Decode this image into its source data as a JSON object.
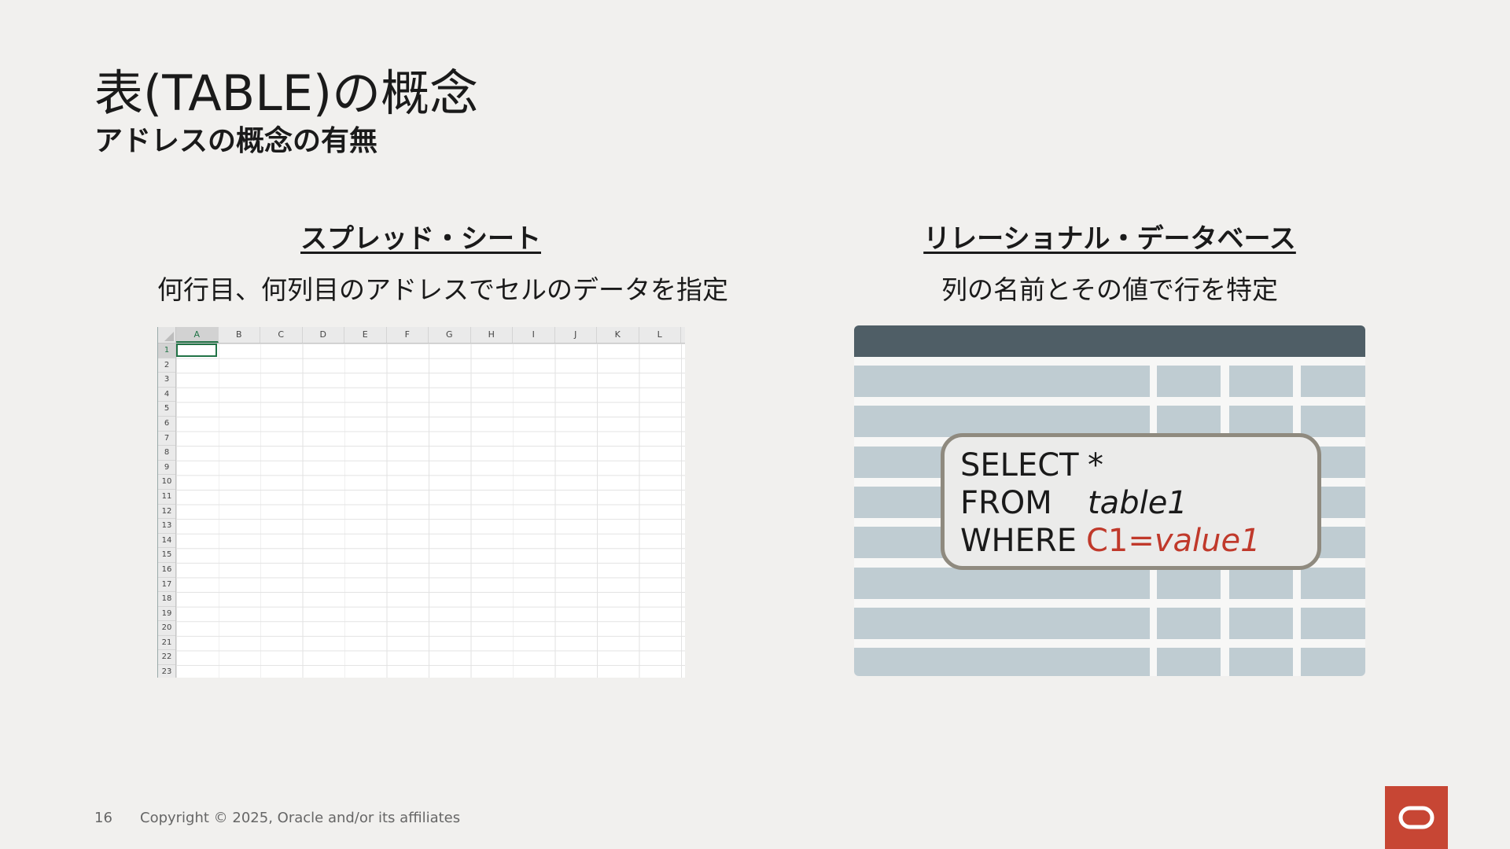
{
  "slide": {
    "title": "表(TABLE)の概念",
    "subtitle": "アドレスの概念の有無",
    "left": {
      "heading": "スプレッド・シート",
      "description": "何行目、何列目のアドレスでセルのデータを指定"
    },
    "right": {
      "heading": "リレーショナル・データベース",
      "description": "列の名前とその値で行を特定"
    },
    "spreadsheet": {
      "columns": [
        "A",
        "B",
        "C",
        "D",
        "E",
        "F",
        "G",
        "H",
        "I",
        "J",
        "K",
        "L"
      ],
      "rows": [
        "1",
        "2",
        "3",
        "4",
        "5",
        "6",
        "7",
        "8",
        "9",
        "10",
        "11",
        "12",
        "13",
        "14",
        "15",
        "16",
        "17",
        "18",
        "19",
        "20",
        "21",
        "22",
        "23"
      ]
    },
    "sql": {
      "select_kw": "SELECT",
      "select_val": "*",
      "from_kw": "FROM",
      "from_val": "table1",
      "where_kw": "WHERE",
      "where_val": "C1=value1"
    },
    "footer": {
      "page_number": "16",
      "copyright": "Copyright © 2025, Oracle and/or its affiliates"
    },
    "colors": {
      "background": "#f1f0ee",
      "oracle_red": "#c74634",
      "table_header": "#4f5e66",
      "table_cell": "#bfccd2",
      "sql_highlight": "#c0392b"
    },
    "icons": {
      "logo": "oracle-logo-icon"
    }
  }
}
